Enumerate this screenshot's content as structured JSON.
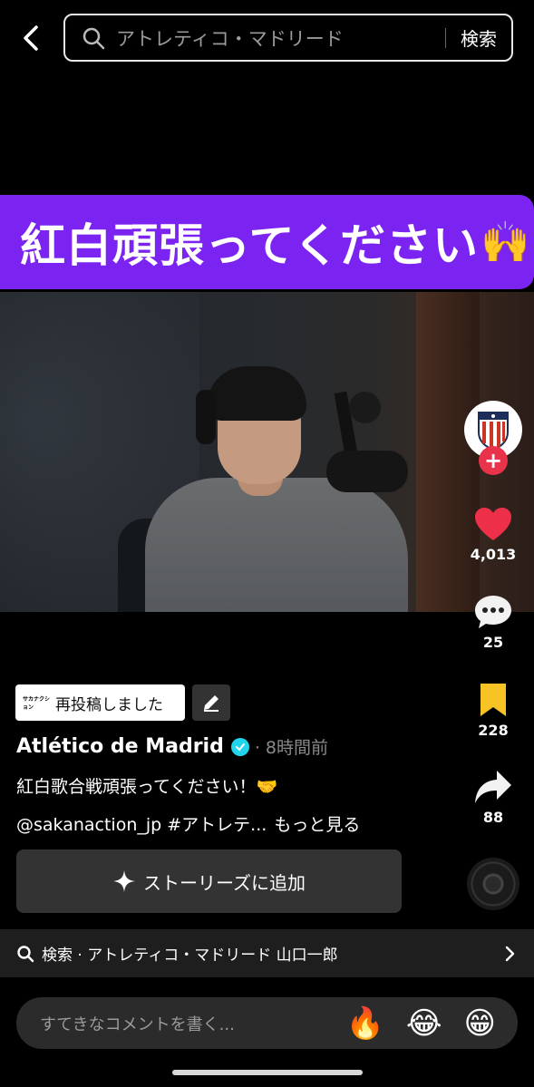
{
  "header": {
    "back_icon": "chevron-left-icon",
    "search_query": "アトレティコ・マドリード",
    "search_button": "検索"
  },
  "video": {
    "caption": "紅白頑張ってください",
    "caption_emoji": "🙌"
  },
  "sidebar": {
    "avatar_icon": "atletico-madrid-crest-icon",
    "likes": "4,013",
    "comments": "25",
    "bookmarks": "228",
    "shares": "88"
  },
  "post": {
    "repost_label": "再投稿しました",
    "repost_logo_text": "サカナクション",
    "author": "Atlético de Madrid",
    "time": "· 8時間前",
    "description": "紅白歌合戦頑張ってください！🤝",
    "tags": "@sakanaction_jp #アトレテ...",
    "more": "もっと見る",
    "story_button": "ストーリーズに追加"
  },
  "related_search": {
    "text": "検索 · アトレティコ・マドリード 山口一郎"
  },
  "comment_bar": {
    "placeholder": "すてきなコメントを書く...",
    "emojis": [
      "🔥",
      "😂",
      "😁"
    ]
  },
  "colors": {
    "accent_purple": "#7b23f0",
    "like_red": "#ee2f4a",
    "bookmark_yellow": "#f7c325",
    "verified_cyan": "#20d5ec"
  }
}
